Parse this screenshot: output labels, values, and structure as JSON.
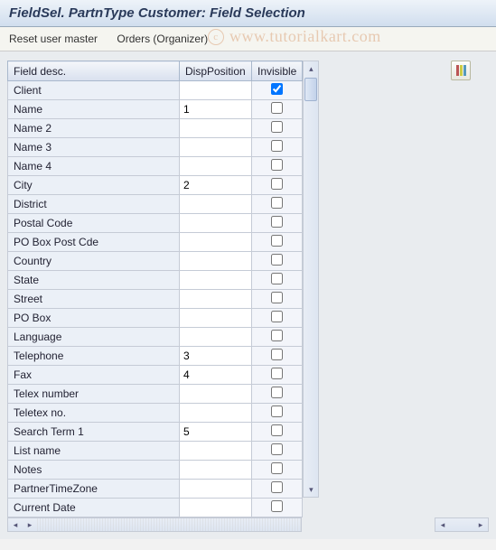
{
  "title": "FieldSel. PartnType Customer: Field Selection",
  "toolbar": {
    "reset_label": "Reset user master",
    "orders_label": "Orders (Organizer)"
  },
  "watermark": "www.tutorialkart.com",
  "columns": {
    "field_desc": "Field desc.",
    "disp_position": "DispPosition",
    "invisible": "Invisible"
  },
  "rows": [
    {
      "label": "Client",
      "disp": "",
      "inv": true
    },
    {
      "label": "Name",
      "disp": "1",
      "inv": false
    },
    {
      "label": "Name 2",
      "disp": "",
      "inv": false
    },
    {
      "label": "Name 3",
      "disp": "",
      "inv": false
    },
    {
      "label": "Name 4",
      "disp": "",
      "inv": false
    },
    {
      "label": "City",
      "disp": "2",
      "inv": false
    },
    {
      "label": "District",
      "disp": "",
      "inv": false
    },
    {
      "label": "Postal Code",
      "disp": "",
      "inv": false
    },
    {
      "label": "PO Box Post Cde",
      "disp": "",
      "inv": false
    },
    {
      "label": "Country",
      "disp": "",
      "inv": false
    },
    {
      "label": "State",
      "disp": "",
      "inv": false
    },
    {
      "label": "Street",
      "disp": "",
      "inv": false
    },
    {
      "label": "PO Box",
      "disp": "",
      "inv": false
    },
    {
      "label": "Language",
      "disp": "",
      "inv": false
    },
    {
      "label": "Telephone",
      "disp": "3",
      "inv": false
    },
    {
      "label": "Fax",
      "disp": "4",
      "inv": false
    },
    {
      "label": "Telex number",
      "disp": "",
      "inv": false
    },
    {
      "label": "Teletex no.",
      "disp": "",
      "inv": false
    },
    {
      "label": "Search Term 1",
      "disp": "5",
      "inv": false
    },
    {
      "label": "List name",
      "disp": "",
      "inv": false
    },
    {
      "label": "Notes",
      "disp": "",
      "inv": false
    },
    {
      "label": "PartnerTimeZone",
      "disp": "",
      "inv": false
    },
    {
      "label": "Current Date",
      "disp": "",
      "inv": false
    }
  ]
}
